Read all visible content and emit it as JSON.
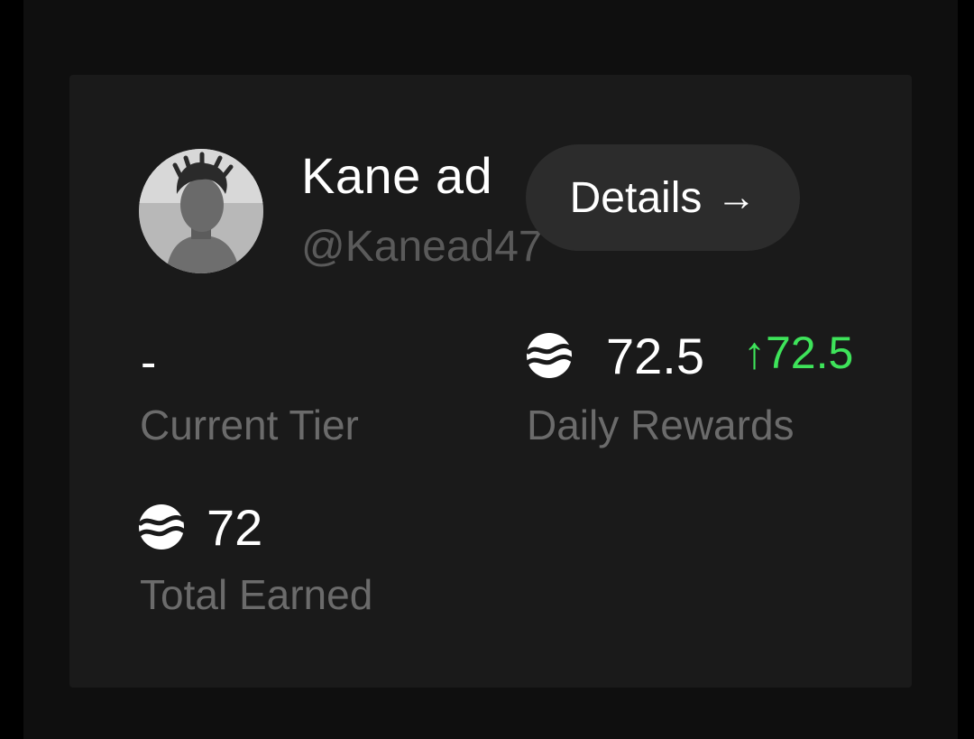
{
  "profile": {
    "name": "Kane ad",
    "handle": "@Kanead47"
  },
  "details_button": {
    "label": "Details",
    "icon": "arrow-right-icon"
  },
  "stats": {
    "current_tier": {
      "value": "-",
      "label": "Current Tier"
    },
    "daily_rewards": {
      "value": "72.5",
      "change": "↑72.5",
      "label": "Daily Rewards",
      "icon": "sui-coin-icon"
    },
    "total_earned": {
      "value": "72",
      "label": "Total Earned",
      "icon": "sui-coin-icon"
    }
  },
  "colors": {
    "background": "#000000",
    "panel": "#0f0f0f",
    "card": "#1a1a1a",
    "button": "#2c2c2c",
    "positive": "#3ee35a",
    "muted_text": "#6b6b6b"
  }
}
